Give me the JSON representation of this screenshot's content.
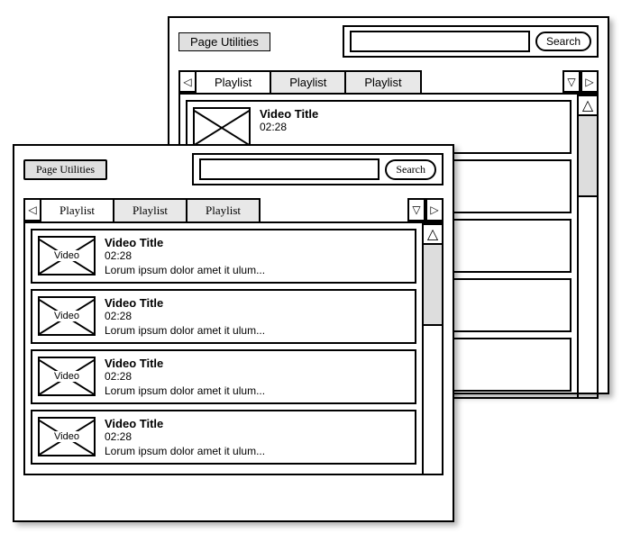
{
  "back": {
    "page_utilities": "Page Utilities",
    "search_label": "Search",
    "tabs": [
      "Playlist",
      "Playlist",
      "Playlist"
    ],
    "rows": [
      {
        "title": "Video Title",
        "time": "02:28",
        "desc": "",
        "thumb": ""
      }
    ]
  },
  "front": {
    "page_utilities": "Page Utilities",
    "search_label": "Search",
    "tabs": [
      "Playlist",
      "Playlist",
      "Playlist"
    ],
    "rows": [
      {
        "title": "Video Title",
        "time": "02:28",
        "desc": "Lorum ipsum dolor amet it ulum...",
        "thumb": "Video"
      },
      {
        "title": "Video Title",
        "time": "02:28",
        "desc": "Lorum ipsum dolor amet it ulum...",
        "thumb": "Video"
      },
      {
        "title": "Video Title",
        "time": "02:28",
        "desc": "Lorum ipsum dolor amet it ulum...",
        "thumb": "Video"
      },
      {
        "title": "Video Title",
        "time": "02:28",
        "desc": "Lorum ipsum dolor amet it ulum...",
        "thumb": "Video"
      }
    ]
  }
}
